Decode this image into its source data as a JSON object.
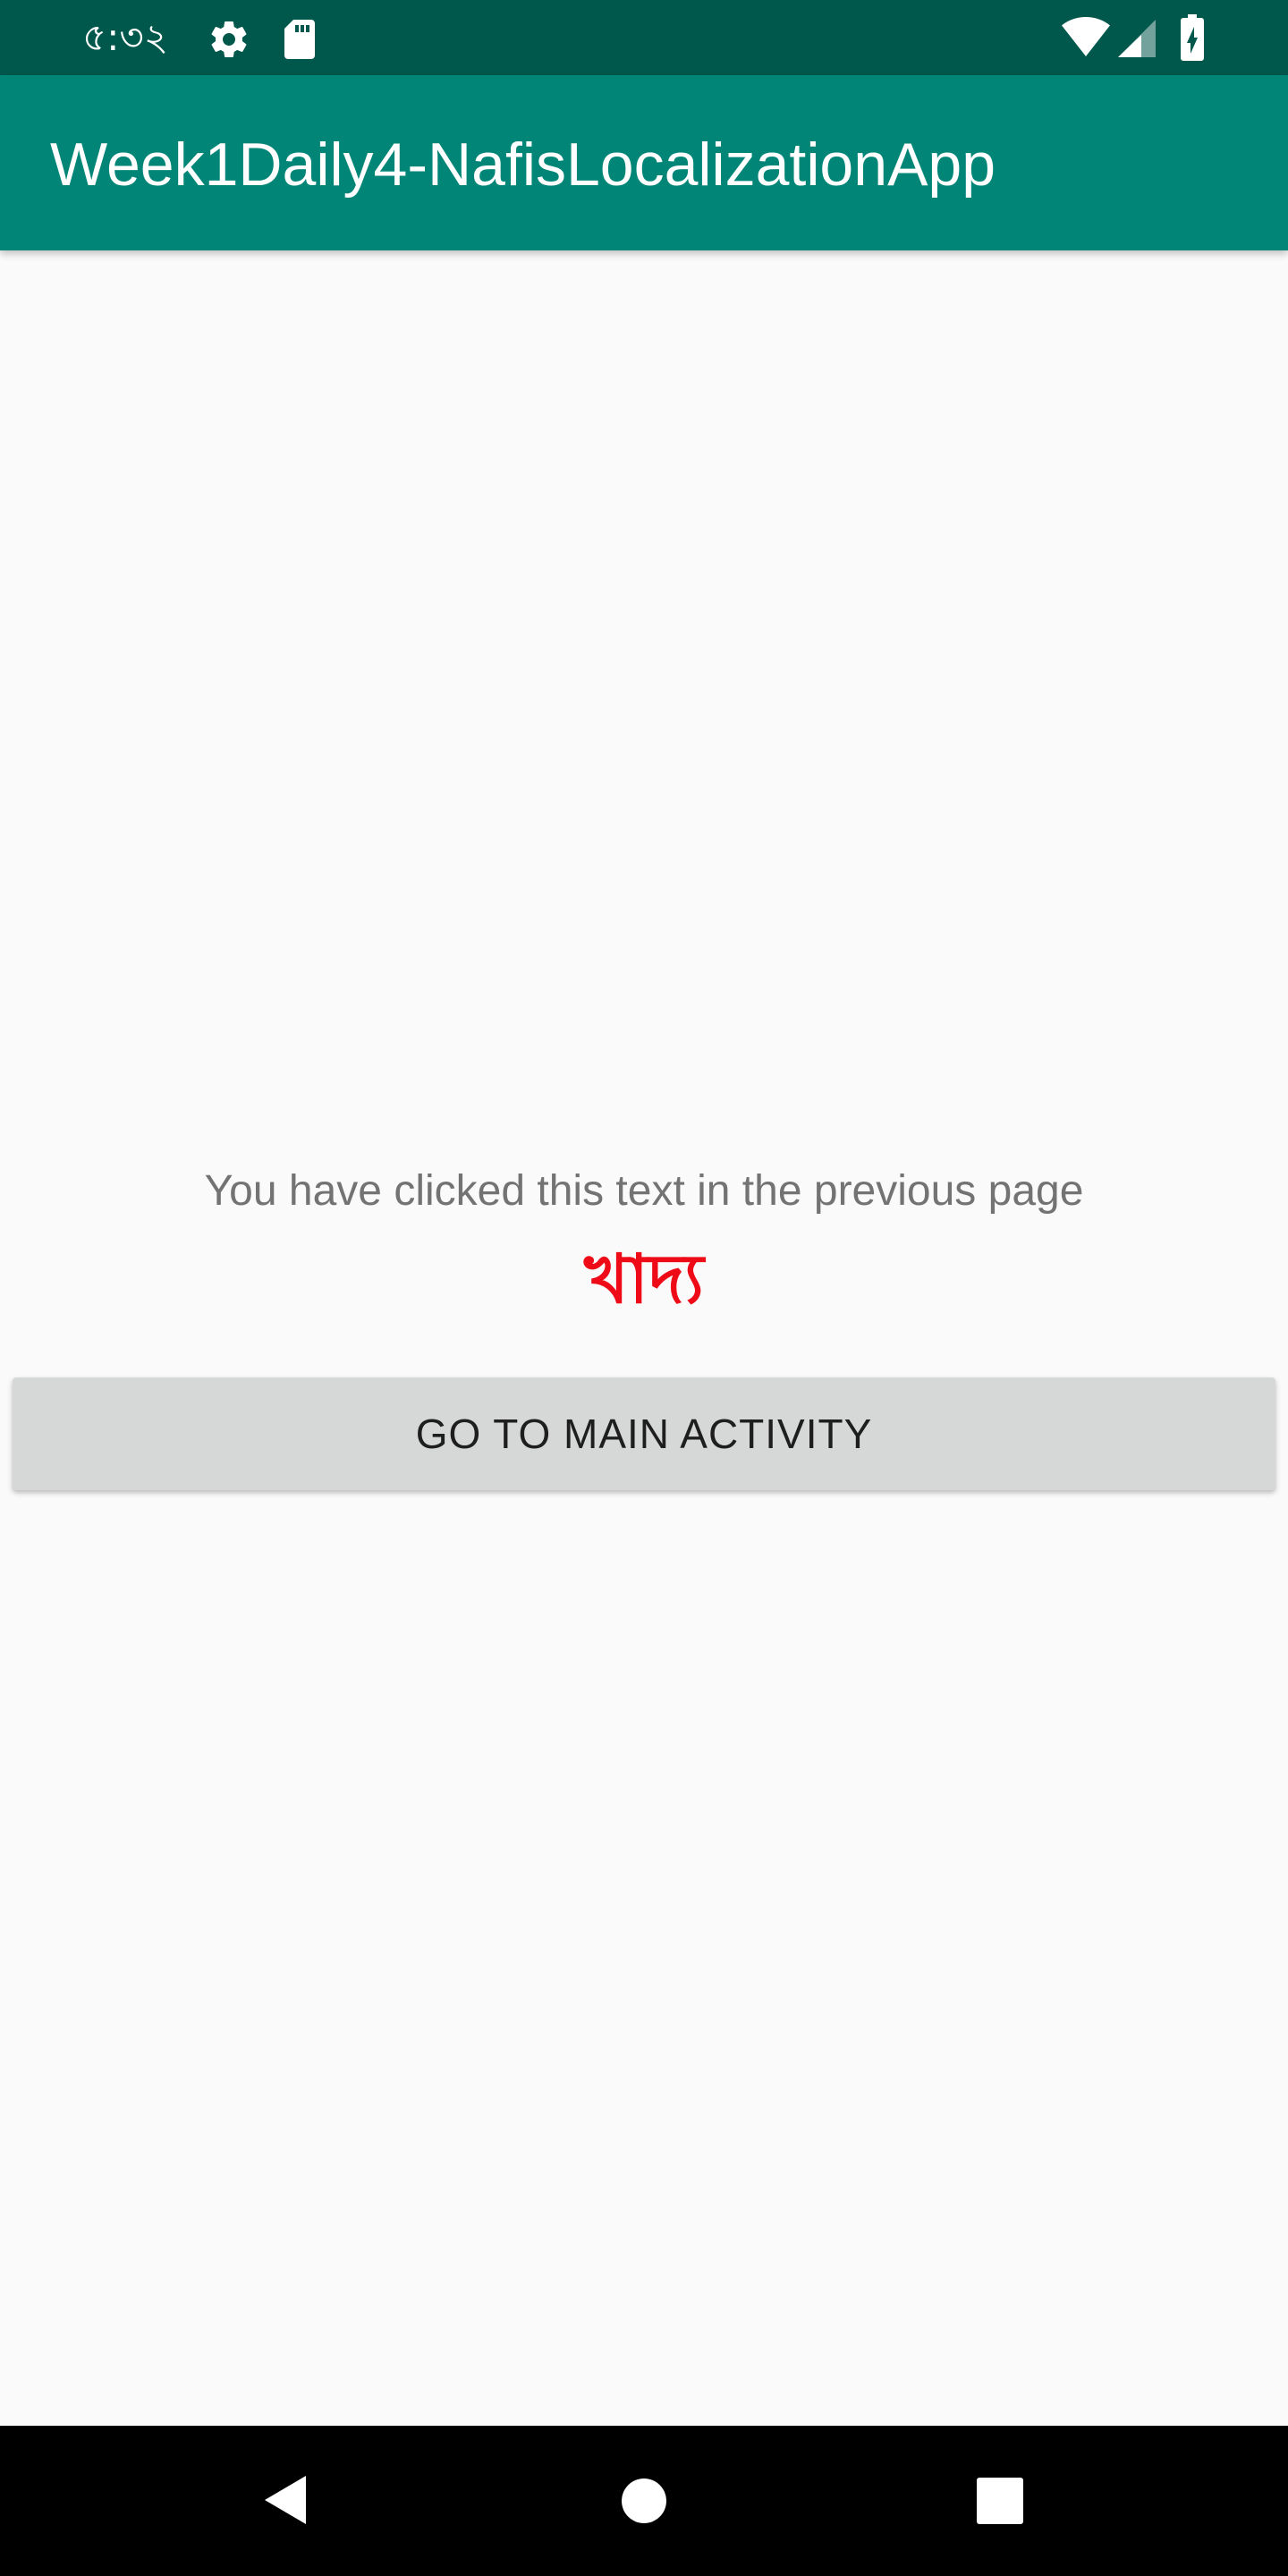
{
  "status_bar": {
    "time": "৫:৩২",
    "icons": [
      "settings-gear-icon",
      "sd-card-icon",
      "wifi-icon",
      "cell-signal-icon",
      "battery-charging-icon"
    ]
  },
  "app_bar": {
    "title": "Week1Daily4-NafisLocalizationApp",
    "color": "#008577",
    "status_color": "#00574b"
  },
  "main": {
    "message": "You have clicked this text in the previous page",
    "clicked_word": "খাদ্য",
    "clicked_word_color": "#ee0a17",
    "button_label": "GO TO MAIN ACTIVITY"
  },
  "nav_bar": {
    "icons": [
      "back-icon",
      "home-icon",
      "recents-icon"
    ]
  }
}
